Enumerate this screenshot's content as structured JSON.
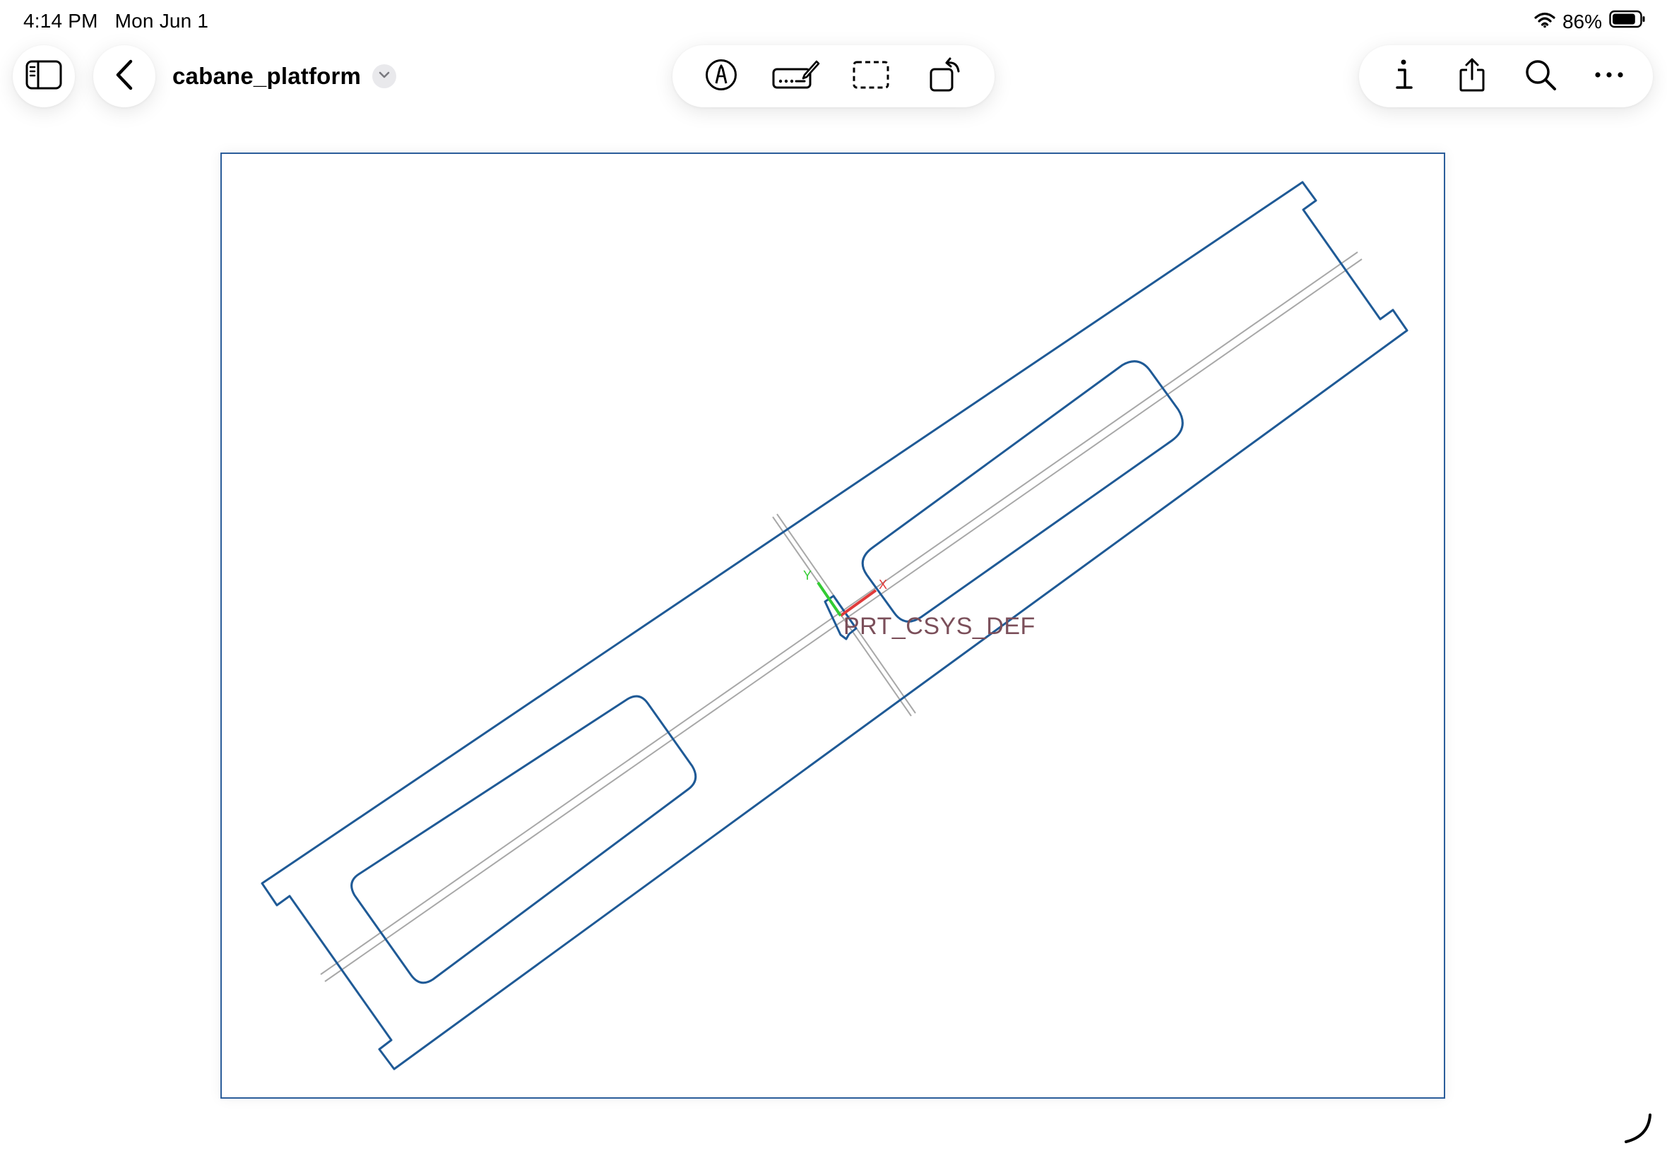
{
  "status_bar": {
    "time": "4:14 PM",
    "date": "Mon Jun 1",
    "battery_percent": "86%",
    "battery_level": 0.86,
    "wifi_icon": "wifi-icon",
    "battery_icon": "battery-icon"
  },
  "header": {
    "document_title": "cabane_platform",
    "sidebar_icon": "sidebar-icon",
    "back_icon": "chevron-left-icon",
    "title_menu_icon": "chevron-down-icon"
  },
  "toolbar_center": [
    {
      "icon": "markup-pen-icon"
    },
    {
      "icon": "signature-keyboard-icon"
    },
    {
      "icon": "selection-rect-icon"
    },
    {
      "icon": "rotate-icon"
    }
  ],
  "toolbar_right": [
    {
      "icon": "info-icon"
    },
    {
      "icon": "share-icon"
    },
    {
      "icon": "search-icon"
    },
    {
      "icon": "more-icon"
    }
  ],
  "drawing": {
    "csys_label": "PRT_CSYS_DEF",
    "outline_color": "#1f5a96",
    "axis_x_color": "#e03a3a",
    "axis_y_color": "#33cc33",
    "axis_x_label": "X",
    "axis_y_label": "Y"
  },
  "colors": {
    "accent": "#2b5d9a",
    "background": "#ffffff"
  }
}
